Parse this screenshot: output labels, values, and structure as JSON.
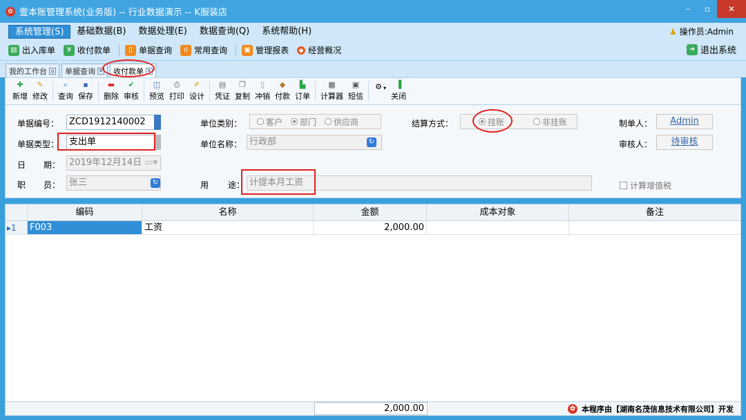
{
  "window": {
    "title": "壹本账管理系统(业务版) -- 行业数据演示 -- K服装店",
    "min": "–",
    "max": "▫",
    "close": "✕"
  },
  "menu": {
    "items": [
      "系统管理(S)",
      "基础数据(B)",
      "数据处理(E)",
      "数据查询(Q)",
      "系统帮助(H)"
    ],
    "operator": "操作员:Admin"
  },
  "quick": {
    "items": [
      "出入库单",
      "收付款单",
      "单据查询",
      "常用查询",
      "管理报表",
      "经营概况"
    ],
    "exit": "退出系统"
  },
  "tabs": [
    {
      "label": "我的工作台"
    },
    {
      "label": "单据查询"
    },
    {
      "label": "收付款单"
    }
  ],
  "toolbar": {
    "new": "新增",
    "edit": "修改",
    "query": "查询",
    "save": "保存",
    "delete": "删除",
    "audit": "审核",
    "preview": "预览",
    "print": "打印",
    "design": "设计",
    "voucher": "凭证",
    "copy": "复制",
    "offset": "冲销",
    "pay": "付款",
    "order": "订单",
    "calculator": "计算器",
    "sms": "短信",
    "close": "关闭"
  },
  "form": {
    "doc_no_label": "单据编号：",
    "doc_no": "ZCD1912140002",
    "doc_type_label": "单据类型：",
    "doc_type": "支出单",
    "date_label_1": "日",
    "date_label_2": "期：",
    "date": "2019年12月14日",
    "staff_label_1": "职",
    "staff_label_2": "员：",
    "staff": "张三",
    "unit_cat_label": "单位类别：",
    "unit_cat_options": [
      "客户",
      "部门",
      "供应商"
    ],
    "unit_name_label": "单位名称：",
    "unit_name": "行政部",
    "purpose_label_1": "用",
    "purpose_label_2": "途：",
    "purpose": "计提本月工资",
    "settle_label": "结算方式：",
    "settle_options": [
      "挂账",
      "非挂账"
    ],
    "maker_label": "制单人：",
    "maker": "Admin",
    "auditor_label": "审核人：",
    "auditor": "待审核",
    "vat_label": "计算增值税"
  },
  "grid": {
    "columns": [
      "编码",
      "名称",
      "金额",
      "成本对象",
      "备注"
    ],
    "rows": [
      {
        "index": "1",
        "code": "F003",
        "name": "工资",
        "amount": "2,000.00",
        "cost_object": "",
        "note": ""
      }
    ],
    "total": "2,000.00"
  },
  "footer": {
    "credit": "本程序由【湖南名茂信息技术有限公司】开发"
  },
  "colors": {
    "accent": "#3aa0dc",
    "highlight": "#e02020",
    "selected": "#2f8fd7"
  }
}
